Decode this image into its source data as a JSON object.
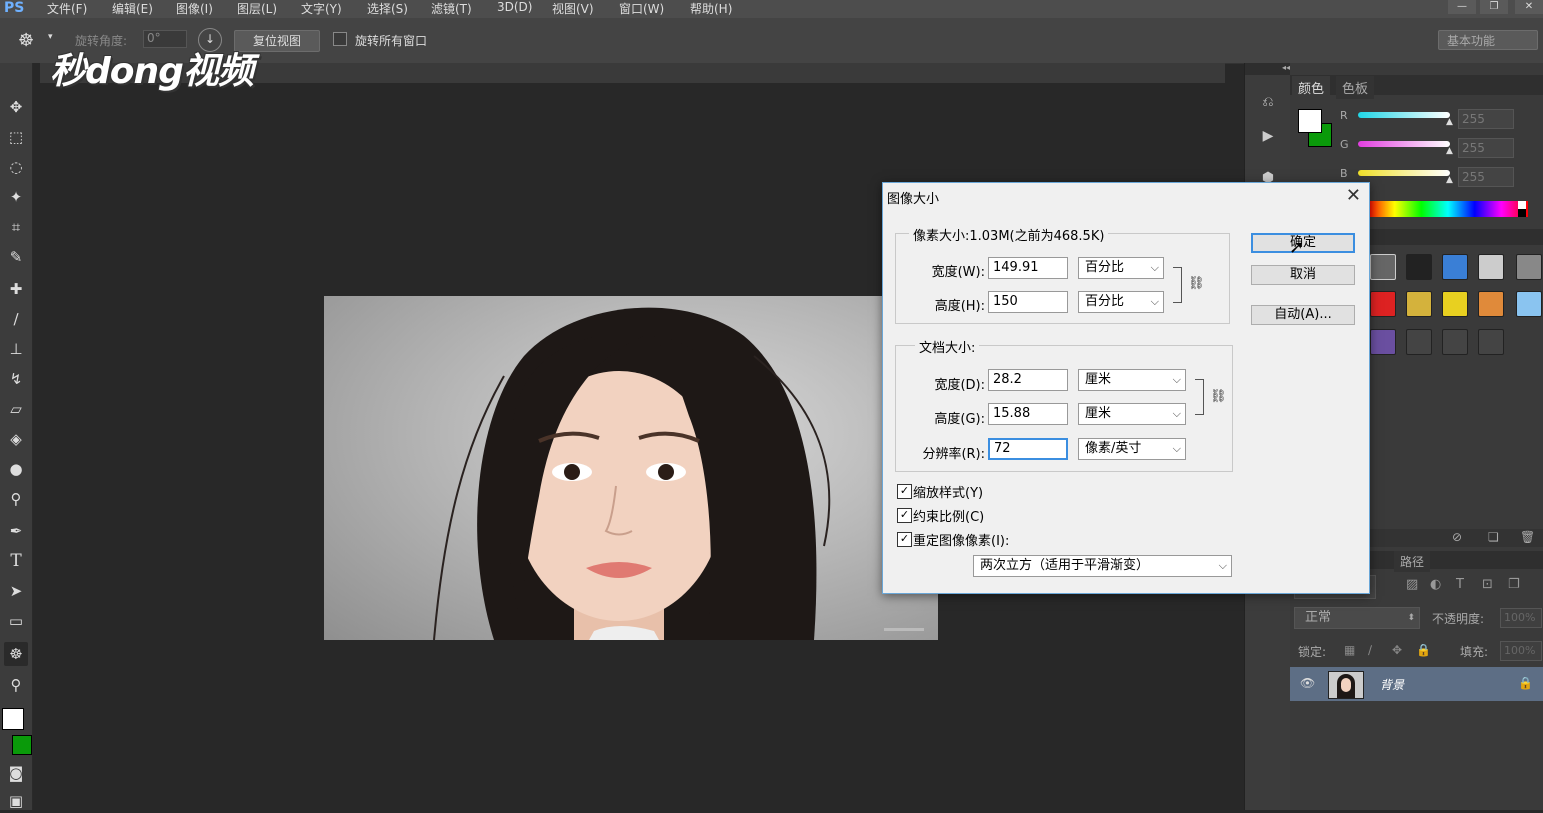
{
  "app": {
    "logo": "PS"
  },
  "menu": [
    "文件(F)",
    "编辑(E)",
    "图像(I)",
    "图层(L)",
    "文字(Y)",
    "选择(S)",
    "滤镜(T)",
    "3D(D)",
    "视图(V)",
    "窗口(W)",
    "帮助(H)"
  ],
  "options_bar": {
    "rotate_label": "旋转角度:",
    "rotate_value": "0°",
    "reset_view": "复位视图",
    "rotate_all": "旋转所有窗口",
    "workspace": "基本功能"
  },
  "watermark": "秒dong视频",
  "color_panel": {
    "tabs": [
      "颜色",
      "色板"
    ],
    "channels": [
      {
        "label": "R",
        "value": "255",
        "color": "#1fd6e6"
      },
      {
        "label": "G",
        "value": "255",
        "color": "#e23de0"
      },
      {
        "label": "B",
        "value": "255",
        "color": "#f0e02a"
      }
    ]
  },
  "layers_panel": {
    "tab_paths": "路径",
    "blend_mode": "正常",
    "opacity_label": "不透明度:",
    "opacity_value": "100%",
    "lock_label": "锁定:",
    "fill_label": "填充:",
    "fill_value": "100%",
    "layer_name": "背景"
  },
  "dialog": {
    "title": "图像大小",
    "pixel_dimensions": "像素大小:1.03M(之前为468.5K)",
    "px_width_label": "宽度(W):",
    "px_width_value": "149.91",
    "px_width_unit": "百分比",
    "px_height_label": "高度(H):",
    "px_height_value": "150",
    "px_height_unit": "百分比",
    "doc_size": "文档大小:",
    "doc_width_label": "宽度(D):",
    "doc_width_value": "28.2",
    "doc_width_unit": "厘米",
    "doc_height_label": "高度(G):",
    "doc_height_value": "15.88",
    "doc_height_unit": "厘米",
    "resolution_label": "分辨率(R):",
    "resolution_value": "72",
    "resolution_unit": "像素/英寸",
    "scale_styles": "缩放样式(Y)",
    "constrain": "约束比例(C)",
    "resample": "重定图像像素(I):",
    "resample_method": "两次立方（适用于平滑渐变）",
    "ok": "确定",
    "cancel": "取消",
    "auto": "自动(A)..."
  }
}
